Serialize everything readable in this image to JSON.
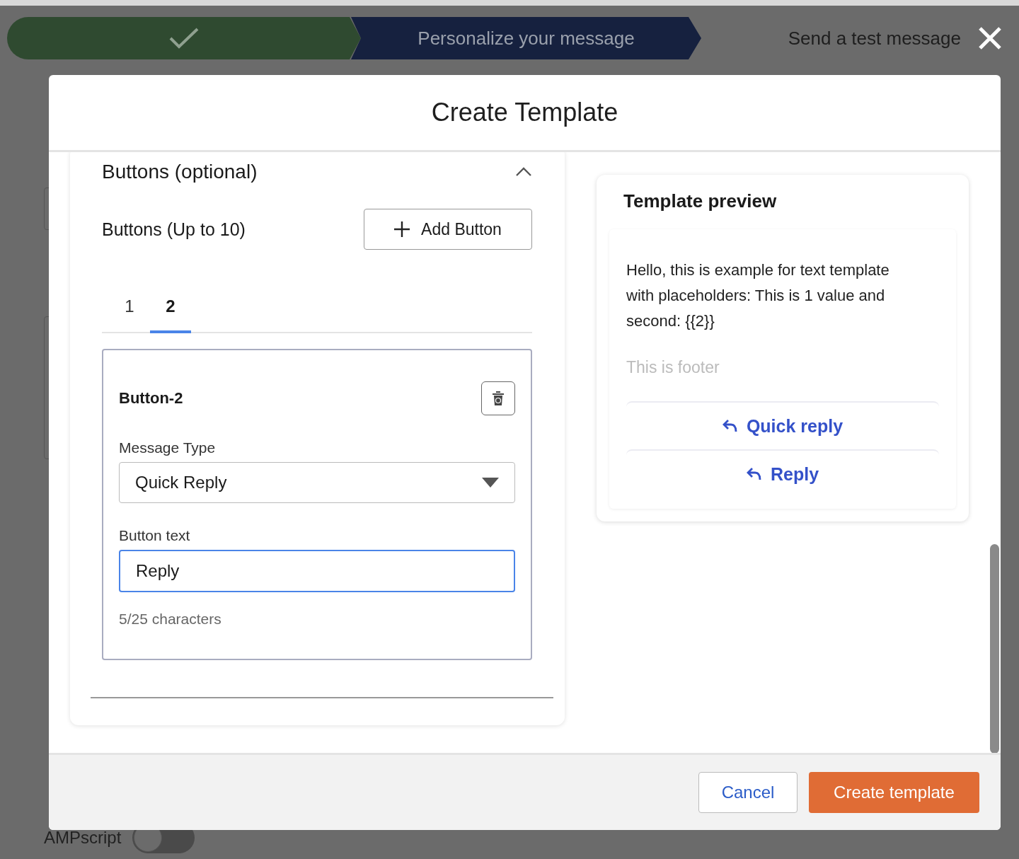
{
  "stepper": {
    "steps": [
      {
        "kind": "complete"
      },
      {
        "kind": "current",
        "label": "Personalize your message"
      },
      {
        "kind": "upcoming",
        "label": "Send a test message"
      }
    ]
  },
  "background": {
    "items": [
      {
        "kind": "field"
      },
      {
        "kind": "area"
      }
    ],
    "ampscript": {
      "label": "AMPscript",
      "on": false
    }
  },
  "modal": {
    "title": "Create Template",
    "buttons_section": {
      "title": "Buttons (optional)",
      "expanded": true,
      "limit_label": "Buttons (Up to 10)",
      "add_button": "Add Button",
      "tabs": [
        {
          "label": "1",
          "selected": false
        },
        {
          "label": "2",
          "selected": true
        }
      ],
      "button_card": {
        "title": "Button-2",
        "message_type_label": "Message Type",
        "message_type": "Quick Reply",
        "button_text_label": "Button text",
        "button_text": "Reply",
        "counter": "5/25 characters"
      }
    },
    "preview": {
      "title": "Template preview",
      "body": "Hello, this is example for text template with placeholders: This is 1 value and second: {{2}}",
      "footer": "This is footer",
      "buttons": [
        "Quick reply",
        "Reply"
      ]
    },
    "footer_buttons": [
      {
        "kind": "secondary",
        "label": "Cancel"
      },
      {
        "kind": "primary",
        "label": "Create template"
      }
    ]
  }
}
